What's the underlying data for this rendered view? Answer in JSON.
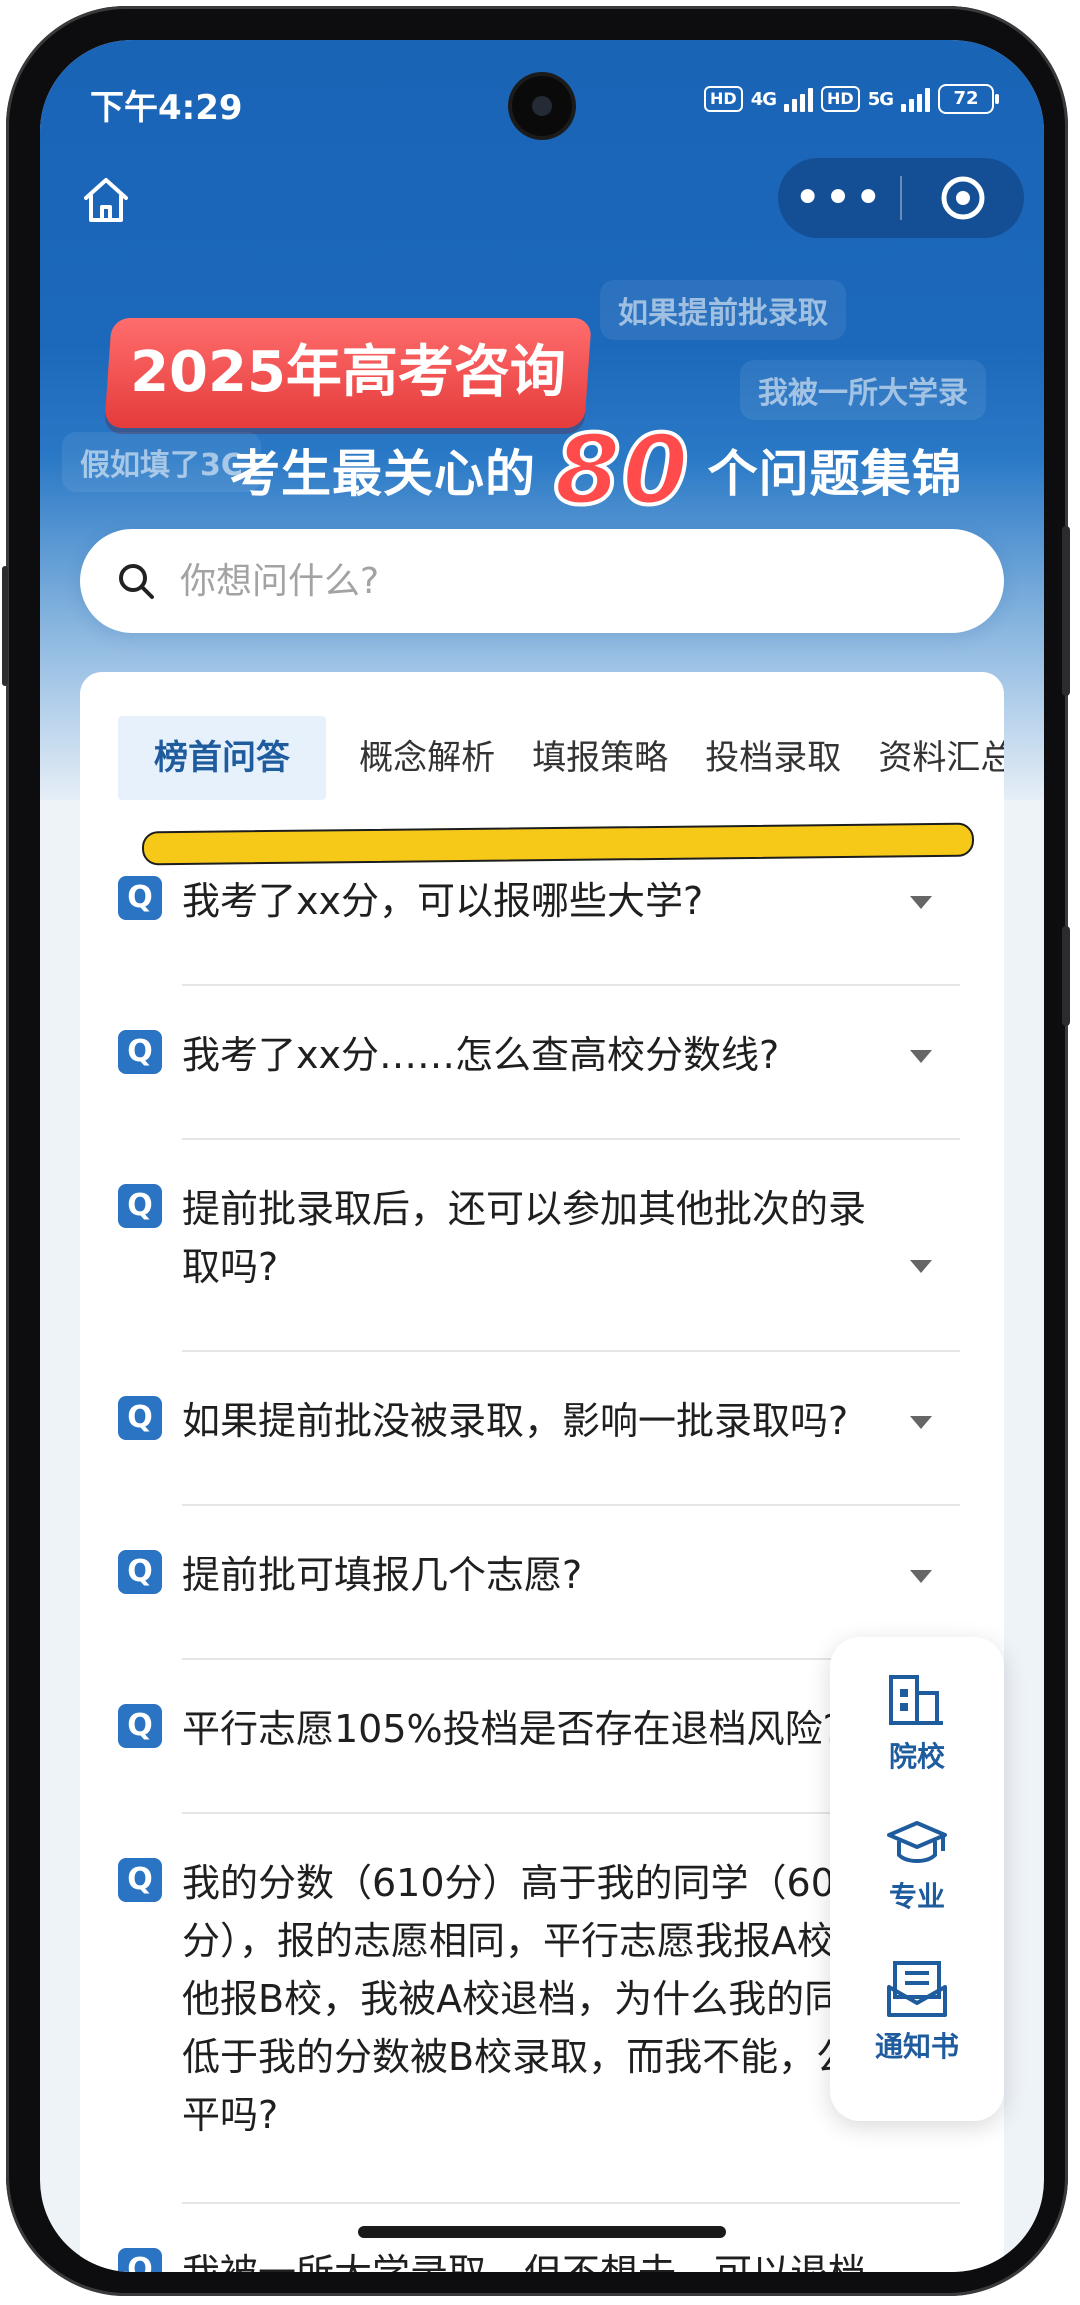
{
  "status_bar": {
    "time": "下午4:29",
    "hd1": "HD",
    "net1": "4G",
    "hd2": "HD",
    "net2": "5G",
    "battery": "72"
  },
  "nav": {
    "more_label": "•••"
  },
  "banner": {
    "bubble_1": "如果提前批录取",
    "bubble_2": "我被一所大学录",
    "bubble_3": "假如填了3C",
    "tag": "2025年高考咨询",
    "subtitle_before": "考生最关心的",
    "subtitle_number": "80",
    "subtitle_after": "个问题集锦"
  },
  "search": {
    "placeholder": "你想问什么?"
  },
  "tabs": [
    {
      "label": "榜首问答",
      "active": true
    },
    {
      "label": "概念解析"
    },
    {
      "label": "填报策略"
    },
    {
      "label": "投档录取"
    },
    {
      "label": "资料汇总"
    }
  ],
  "questions": [
    {
      "badge": "Q",
      "text": "我考了xx分，可以报哪些大学?"
    },
    {
      "badge": "Q",
      "text": "我考了xx分……怎么查高校分数线?"
    },
    {
      "badge": "Q",
      "text": "提前批录取后，还可以参加其他批次的录取吗?"
    },
    {
      "badge": "Q",
      "text": "如果提前批没被录取，影响一批录取吗?"
    },
    {
      "badge": "Q",
      "text": "提前批可填报几个志愿?"
    },
    {
      "badge": "Q",
      "text": "平行志愿105%投档是否存在退档风险?"
    },
    {
      "badge": "Q",
      "text": "我的分数（610分）高于我的同学（607分），报的志愿相同，平行志愿我报A校，他报B校，我被A校退档，为什么我的同学低于我的分数被B校录取，而我不能，公平吗?"
    },
    {
      "badge": "Q",
      "text": "我被一所大学录取，但不想去，可以退档"
    }
  ],
  "float_nav": [
    {
      "label": "院校",
      "icon": "building-icon"
    },
    {
      "label": "专业",
      "icon": "graduation-cap-icon"
    },
    {
      "label": "通知书",
      "icon": "envelope-icon"
    }
  ],
  "colors": {
    "primary_blue": "#1c68ba",
    "tag_red": "#e53b3b",
    "highlight_yellow": "#f6c919",
    "badge_blue": "#2b73c3",
    "label_blue": "#1f5c9e"
  }
}
